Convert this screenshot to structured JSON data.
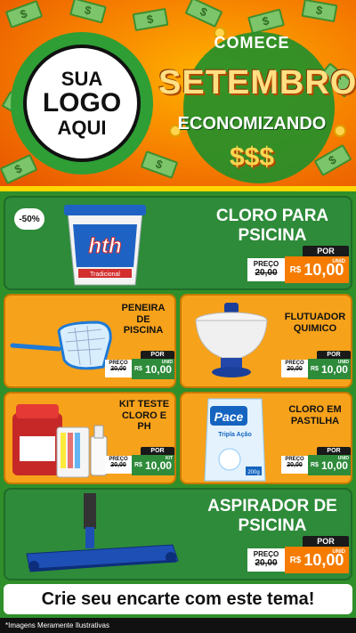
{
  "header": {
    "logo": {
      "line1": "SUA",
      "line2": "LOGO",
      "line3": "AQUI"
    },
    "campaign": {
      "line1": "COMECE",
      "line2": "SETEMBRO",
      "line3": "ECONOMIZANDO",
      "line4": "$$$"
    }
  },
  "products": [
    {
      "name_l1": "CLORO PARA",
      "name_l2": "PSICINA",
      "discount": "-50%",
      "label_preco": "PREÇO",
      "label_por": "POR",
      "old_price": "20,00",
      "currency": "R$",
      "price": "10,00",
      "unit": "UNID"
    },
    {
      "name_l1": "PENEIRA",
      "name_l2": "DE",
      "name_l3": "PISCINA",
      "label_preco": "PREÇO",
      "label_por": "POR",
      "old_price": "20,00",
      "currency": "R$",
      "price": "10,00",
      "unit": "UNID"
    },
    {
      "name_l1": "FLUTUADOR",
      "name_l2": "QUIMICO",
      "label_preco": "PREÇO",
      "label_por": "POR",
      "old_price": "20,00",
      "currency": "R$",
      "price": "10,00",
      "unit": "UNID"
    },
    {
      "name_l1": "KIT TESTE",
      "name_l2": "CLORO E",
      "name_l3": "PH",
      "label_preco": "PREÇO",
      "label_por": "POR",
      "old_price": "20,00",
      "currency": "R$",
      "price": "10,00",
      "unit": "KIT"
    },
    {
      "name_l1": "CLORO EM",
      "name_l2": "PASTILHA",
      "label_preco": "PREÇO",
      "label_por": "POR",
      "old_price": "20,00",
      "currency": "R$",
      "price": "10,00",
      "unit": "UNID"
    },
    {
      "name_l1": "ASPIRADOR DE",
      "name_l2": "PSICINA",
      "label_preco": "PREÇO",
      "label_por": "POR",
      "old_price": "20,00",
      "currency": "R$",
      "price": "10,00",
      "unit": "UNID"
    }
  ],
  "product_images": {
    "bucket_brand": "hth",
    "bucket_sublabel": "Tradicional",
    "tablet_brand": "Pace",
    "tablet_sublabel": "Tripla Ação",
    "tablet_weight": "200g"
  },
  "footer": {
    "cta": "Crie seu encarte com este tema!",
    "disclaimer": "*Imagens Meramente Ilustrativas"
  },
  "colors": {
    "orange": "#f7a21b",
    "green": "#2e8b3a",
    "price_orange": "#f57c00",
    "yellow": "#ffd600"
  }
}
